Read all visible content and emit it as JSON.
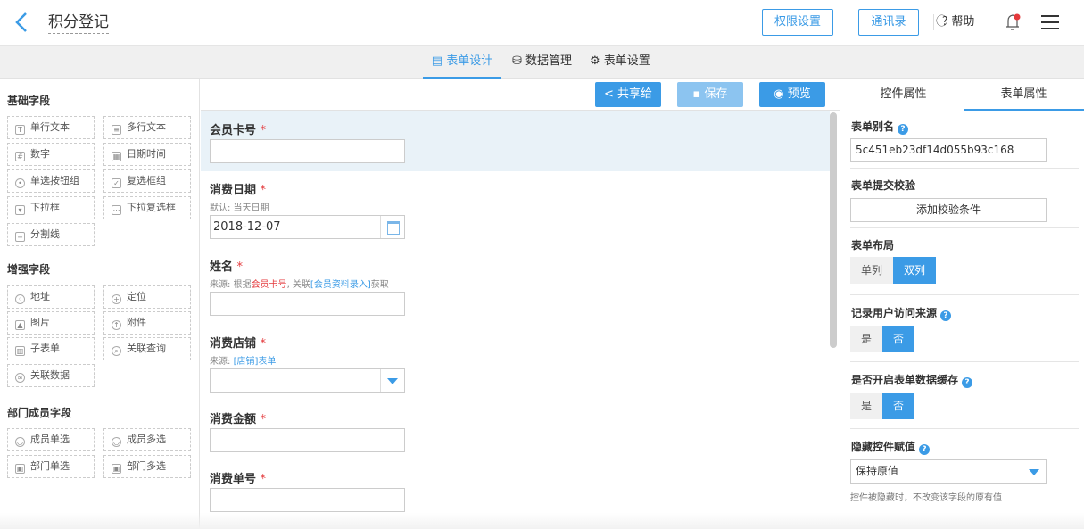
{
  "header": {
    "title": "积分登记",
    "perm_btn": "权限设置",
    "contacts_btn": "通讯录",
    "help": "帮助"
  },
  "tabs": [
    {
      "label": "表单设计"
    },
    {
      "label": "数据管理"
    },
    {
      "label": "表单设置"
    }
  ],
  "left": {
    "basic_title": "基础字段",
    "basic": [
      "单行文本",
      "多行文本",
      "数字",
      "日期时间",
      "单选按钮组",
      "复选框组",
      "下拉框",
      "下拉复选框",
      "分割线"
    ],
    "enhanced_title": "增强字段",
    "enhanced": [
      "地址",
      "定位",
      "图片",
      "附件",
      "子表单",
      "关联查询",
      "关联数据"
    ],
    "member_title": "部门成员字段",
    "member": [
      "成员单选",
      "成员多选",
      "部门单选",
      "部门多选"
    ]
  },
  "toolbar": {
    "share": "共享给",
    "save": "保存",
    "preview": "预览"
  },
  "form": {
    "f1": {
      "label": "会员卡号",
      "req": "*"
    },
    "f2": {
      "label": "消费日期",
      "req": "*",
      "sub": "默认: 当天日期",
      "value": "2018-12-07"
    },
    "f3": {
      "label": "姓名",
      "req": "*",
      "sub_pre": "来源: 根据",
      "sub_red": "会员卡号",
      "sub_mid": ", 关联",
      "sub_blue": "[会员资料录入]",
      "sub_post": "获取"
    },
    "f4": {
      "label": "消费店铺",
      "req": "*",
      "sub_pre": "来源: ",
      "sub_blue": "[店铺]表单"
    },
    "f5": {
      "label": "消费金额",
      "req": "*"
    },
    "f6": {
      "label": "消费单号",
      "req": "*"
    }
  },
  "right": {
    "tab1": "控件属性",
    "tab2": "表单属性",
    "alias_label": "表单别名",
    "alias_value": "5c451eb23df14d055b93c168",
    "validate_label": "表单提交校验",
    "validate_btn": "添加校验条件",
    "layout_label": "表单布局",
    "layout_opts": [
      "单列",
      "双列"
    ],
    "record_label": "记录用户访问来源",
    "record_opts": [
      "是",
      "否"
    ],
    "cache_label": "是否开启表单数据缓存",
    "cache_opts": [
      "是",
      "否"
    ],
    "hidden_label": "隐藏控件赋值",
    "hidden_value": "保持原值",
    "hidden_hint": "控件被隐藏时，不改变该字段的原有值"
  },
  "colors": {
    "accent": "#3b9be6"
  }
}
